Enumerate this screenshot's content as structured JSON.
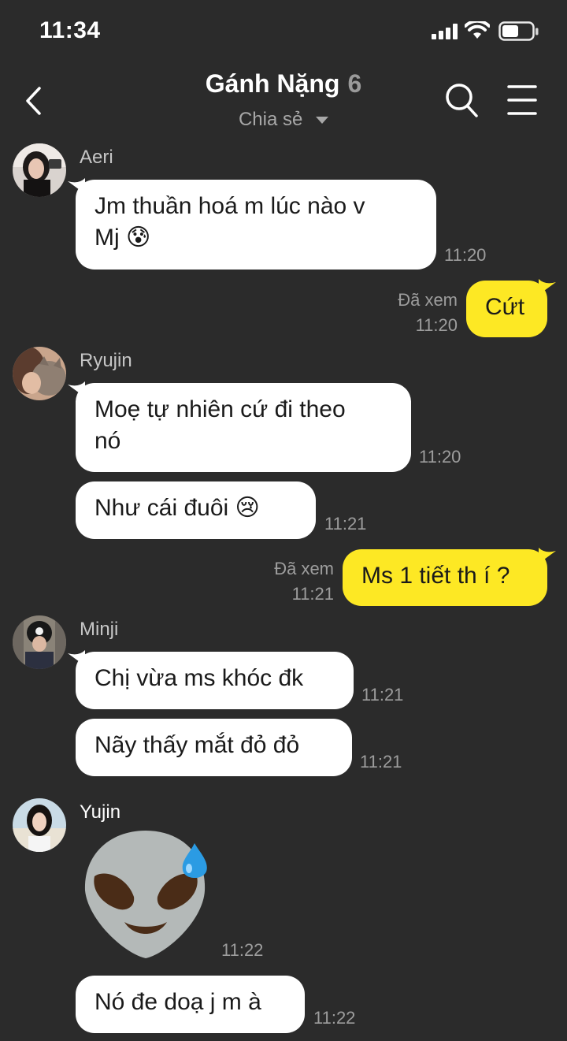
{
  "status_bar": {
    "time": "11:34"
  },
  "header": {
    "title": "Gánh Nặng",
    "member_count": "6",
    "subtitle": "Chia sẻ"
  },
  "colors": {
    "background": "#2b2b2b",
    "incoming_bubble": "#ffffff",
    "outgoing_bubble": "#fde824",
    "muted_text": "#9d9d9d"
  },
  "messages": {
    "m1": {
      "sender": "Aeri",
      "text_line1": "Jm thuần hoá m lúc nào v",
      "text_line2": "Mj",
      "emoji": "😰",
      "time": "11:20"
    },
    "m2": {
      "read": "Đã xem",
      "time": "11:20",
      "text": "Cứt"
    },
    "m3": {
      "sender": "Ryujin",
      "text_line1": "Moẹ tự nhiên cứ đi theo",
      "text_line2": "nó",
      "time": "11:20"
    },
    "m4": {
      "text": "Như cái đuôi",
      "emoji": "😢",
      "time": "11:21"
    },
    "m5": {
      "read": "Đã xem",
      "time": "11:21",
      "text": "Ms 1 tiết th í ?"
    },
    "m6": {
      "sender": "Minji",
      "text": "Chị vừa ms khóc đk",
      "time": "11:21"
    },
    "m7": {
      "text": "Nãy thấy mắt đỏ đỏ",
      "time": "11:21"
    },
    "m8": {
      "sender": "Yujin",
      "sticker": "alien-sweat-sticker",
      "time": "11:22"
    },
    "m9": {
      "text": "Nó đe doạ j m à",
      "time": "11:22"
    }
  }
}
